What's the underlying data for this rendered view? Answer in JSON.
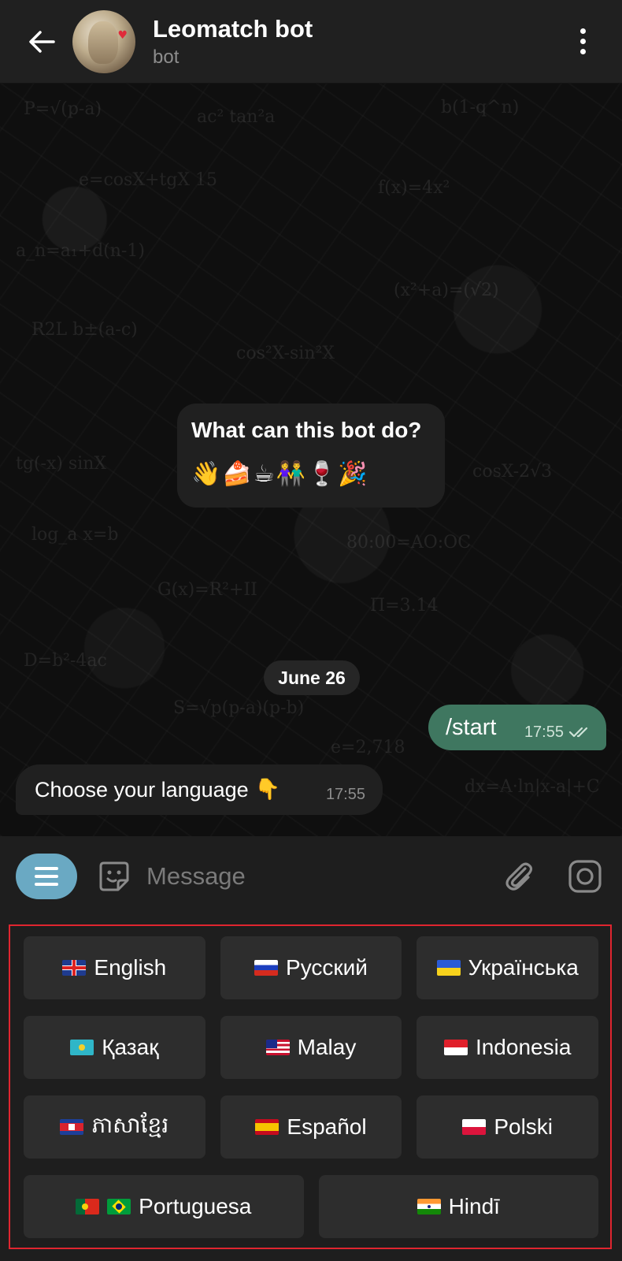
{
  "header": {
    "title": "Leomatch bot",
    "subtitle": "bot"
  },
  "chat": {
    "intro": {
      "title": "What can this bot do?",
      "emoji": "👋🍰☕👫🍷🎉"
    },
    "date": "June 26",
    "messages": [
      {
        "direction": "out",
        "text": "/start",
        "time": "17:55",
        "status": "read"
      },
      {
        "direction": "in",
        "text": "Choose your language",
        "emoji": "👇",
        "time": "17:55"
      }
    ]
  },
  "input": {
    "placeholder": "Message"
  },
  "keyboard": {
    "rows": [
      [
        {
          "label": "English",
          "flags": [
            "uk"
          ]
        },
        {
          "label": "Русский",
          "flags": [
            "ru"
          ]
        },
        {
          "label": "Українська",
          "flags": [
            "ua"
          ]
        }
      ],
      [
        {
          "label": "Қазақ",
          "flags": [
            "kz"
          ]
        },
        {
          "label": "Malay",
          "flags": [
            "my"
          ]
        },
        {
          "label": "Indonesia",
          "flags": [
            "id"
          ]
        }
      ],
      [
        {
          "label": "ភាសាខ្មែរ",
          "flags": [
            "kh"
          ]
        },
        {
          "label": "Español",
          "flags": [
            "es"
          ]
        },
        {
          "label": "Polski",
          "flags": [
            "pl"
          ]
        }
      ],
      [
        {
          "label": "Portuguesa",
          "flags": [
            "pt",
            "br"
          ]
        },
        {
          "label": "Hindī",
          "flags": [
            "in"
          ]
        }
      ]
    ],
    "highlight_color": "#e0252f"
  },
  "colors": {
    "outgoing_bubble": "#3f7760",
    "menu_button": "#6aa9c3",
    "header_bg": "#202020"
  },
  "icons": [
    "back-arrow-icon",
    "more-vertical-icon",
    "menu-icon",
    "sticker-icon",
    "paperclip-icon",
    "camera-icon",
    "double-check-icon"
  ]
}
